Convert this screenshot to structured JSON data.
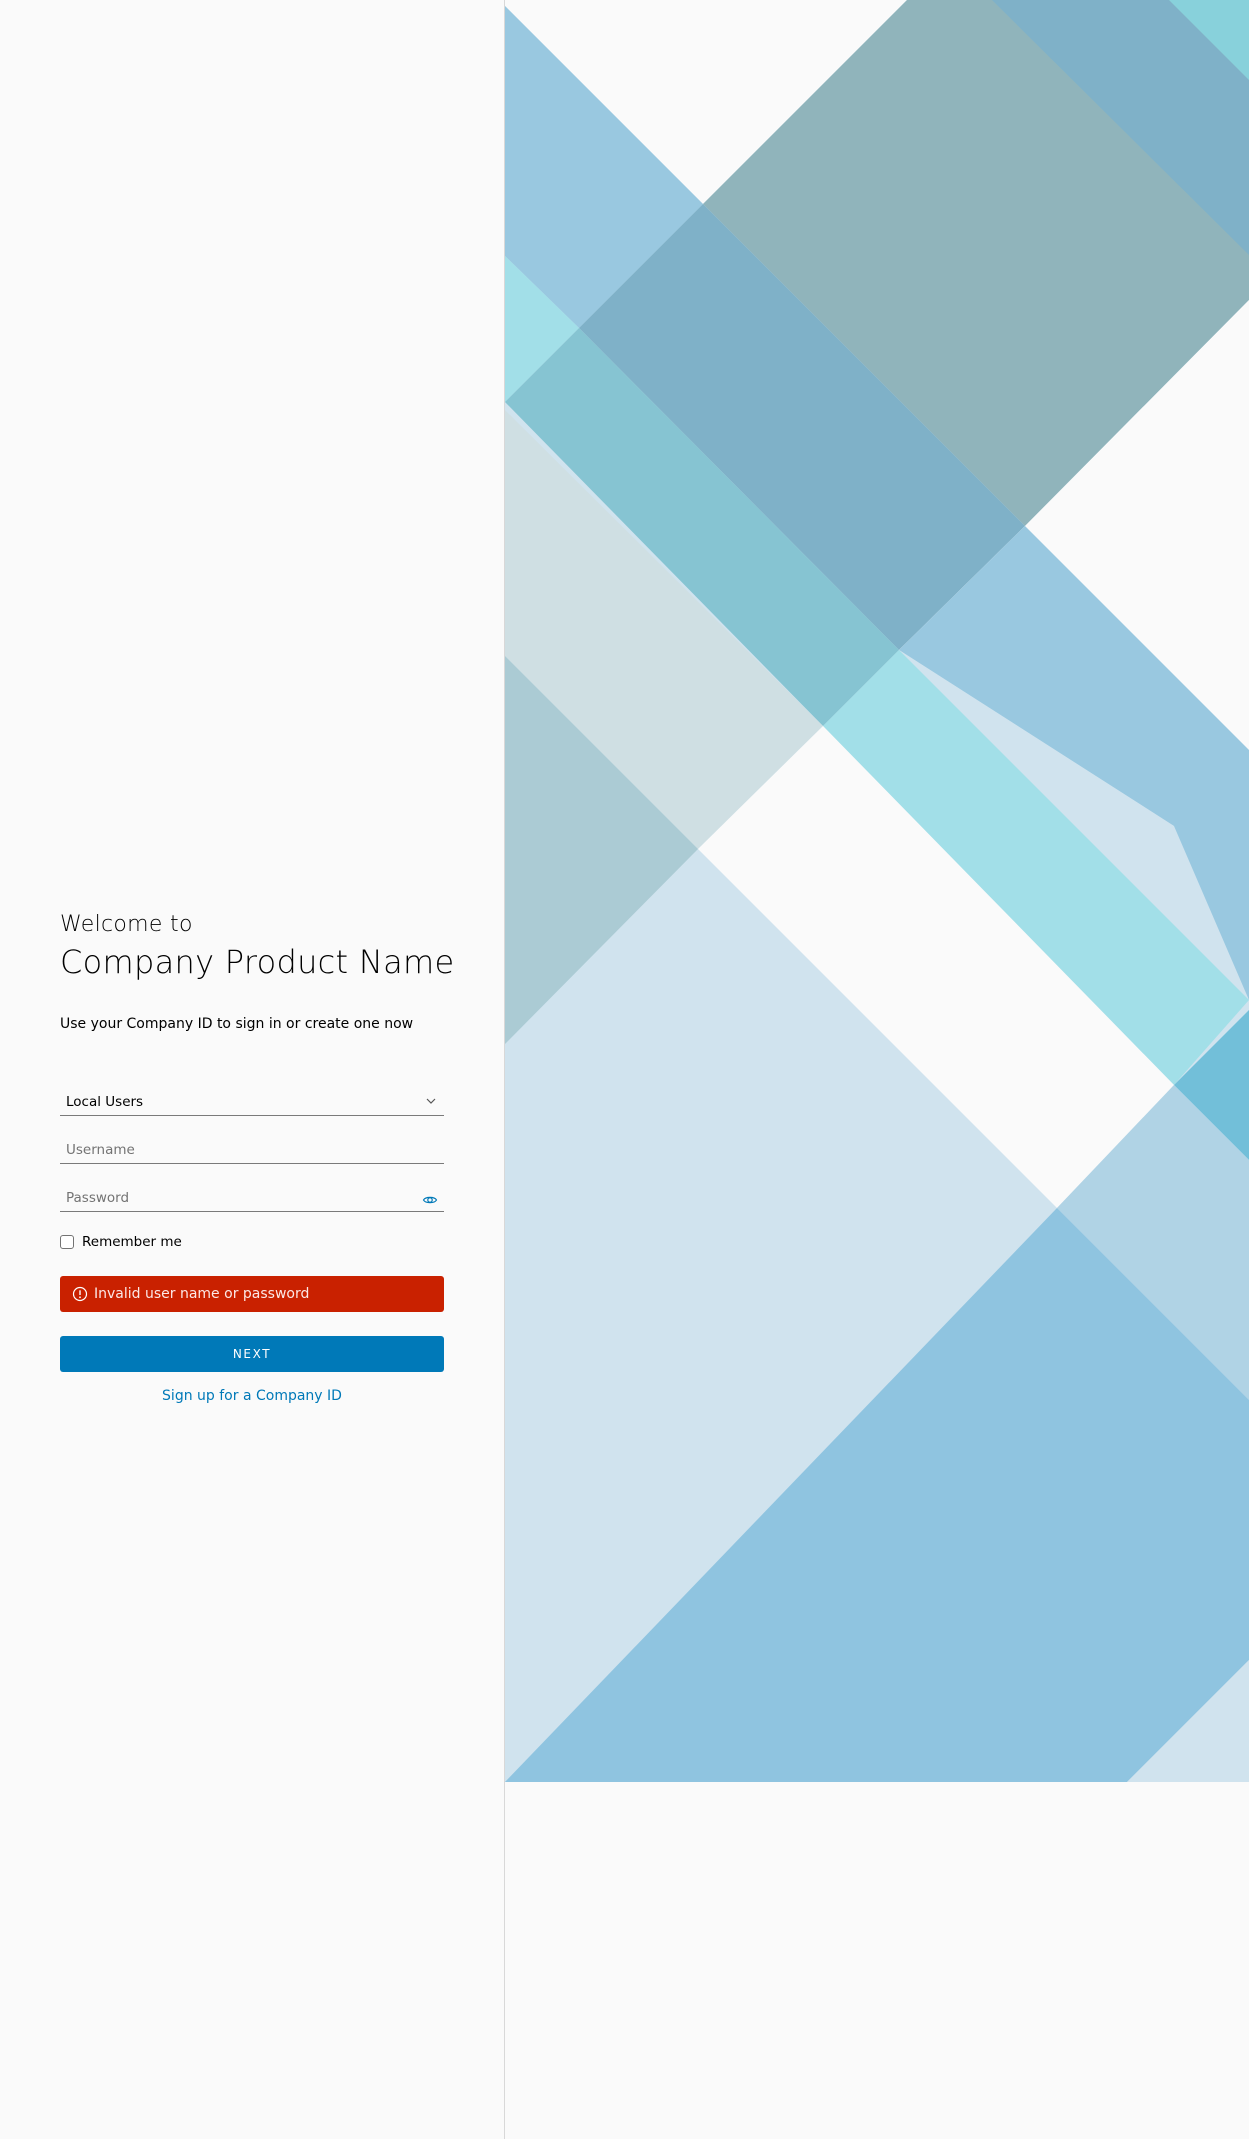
{
  "login": {
    "welcome": "Welcome to",
    "product_name": "Company Product Name",
    "subtitle": "Use your Company ID to sign in or create one now",
    "domain_select": {
      "value": "Local Users"
    },
    "username": {
      "placeholder": "Username"
    },
    "password": {
      "placeholder": "Password"
    },
    "remember_me": "Remember me",
    "error": "Invalid user name or password",
    "next_label": "NEXT",
    "signup_link": "Sign up for a Company ID"
  },
  "colors": {
    "primary": "#0079b8",
    "error": "#c92100",
    "background": "#fafafa"
  },
  "icons": {
    "select": "chevron-down-icon",
    "password": "eye-icon",
    "error": "exclamation-circle-icon"
  }
}
